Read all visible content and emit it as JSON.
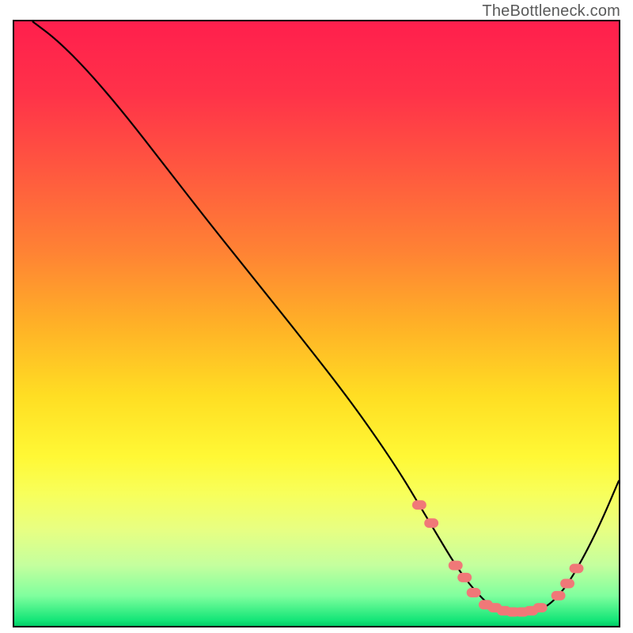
{
  "watermark": "TheBottleneck.com",
  "colors": {
    "marker": "#f07878",
    "line": "#000000",
    "border": "#000000"
  },
  "chart_data": {
    "type": "line",
    "title": "",
    "xlabel": "",
    "ylabel": "",
    "xlim": [
      0,
      100
    ],
    "ylim": [
      0,
      100
    ],
    "gradient_stops": [
      {
        "offset": 0,
        "color": "#ff1f4d"
      },
      {
        "offset": 12,
        "color": "#ff3249"
      },
      {
        "offset": 25,
        "color": "#ff593f"
      },
      {
        "offset": 38,
        "color": "#ff8234"
      },
      {
        "offset": 50,
        "color": "#ffb027"
      },
      {
        "offset": 62,
        "color": "#ffde23"
      },
      {
        "offset": 72,
        "color": "#fff835"
      },
      {
        "offset": 78,
        "color": "#f8ff5a"
      },
      {
        "offset": 84,
        "color": "#e8ff82"
      },
      {
        "offset": 90,
        "color": "#c4ff9e"
      },
      {
        "offset": 95,
        "color": "#80ff9e"
      },
      {
        "offset": 99,
        "color": "#15e678"
      },
      {
        "offset": 100,
        "color": "#00cc66"
      }
    ],
    "series": [
      {
        "name": "bottleneck-curve",
        "x": [
          3,
          7,
          12,
          18,
          25,
          32,
          40,
          48,
          55,
          60,
          64,
          67,
          70,
          73,
          76,
          79,
          82,
          85,
          88,
          91,
          94,
          97,
          100
        ],
        "y": [
          100,
          97,
          92,
          85,
          76,
          67,
          57,
          47,
          38,
          31,
          25,
          20,
          15,
          10,
          6,
          3,
          2,
          2,
          3,
          6,
          11,
          17,
          24
        ]
      }
    ],
    "markers": {
      "name": "data-points",
      "x": [
        67,
        69,
        73,
        74.5,
        76,
        78,
        79.5,
        81,
        82.5,
        84,
        85.5,
        87,
        90,
        91.5,
        93
      ],
      "y": [
        20,
        17,
        10,
        8,
        5.5,
        3.5,
        3,
        2.5,
        2.3,
        2.3,
        2.5,
        3,
        5,
        7,
        9.5
      ]
    }
  }
}
